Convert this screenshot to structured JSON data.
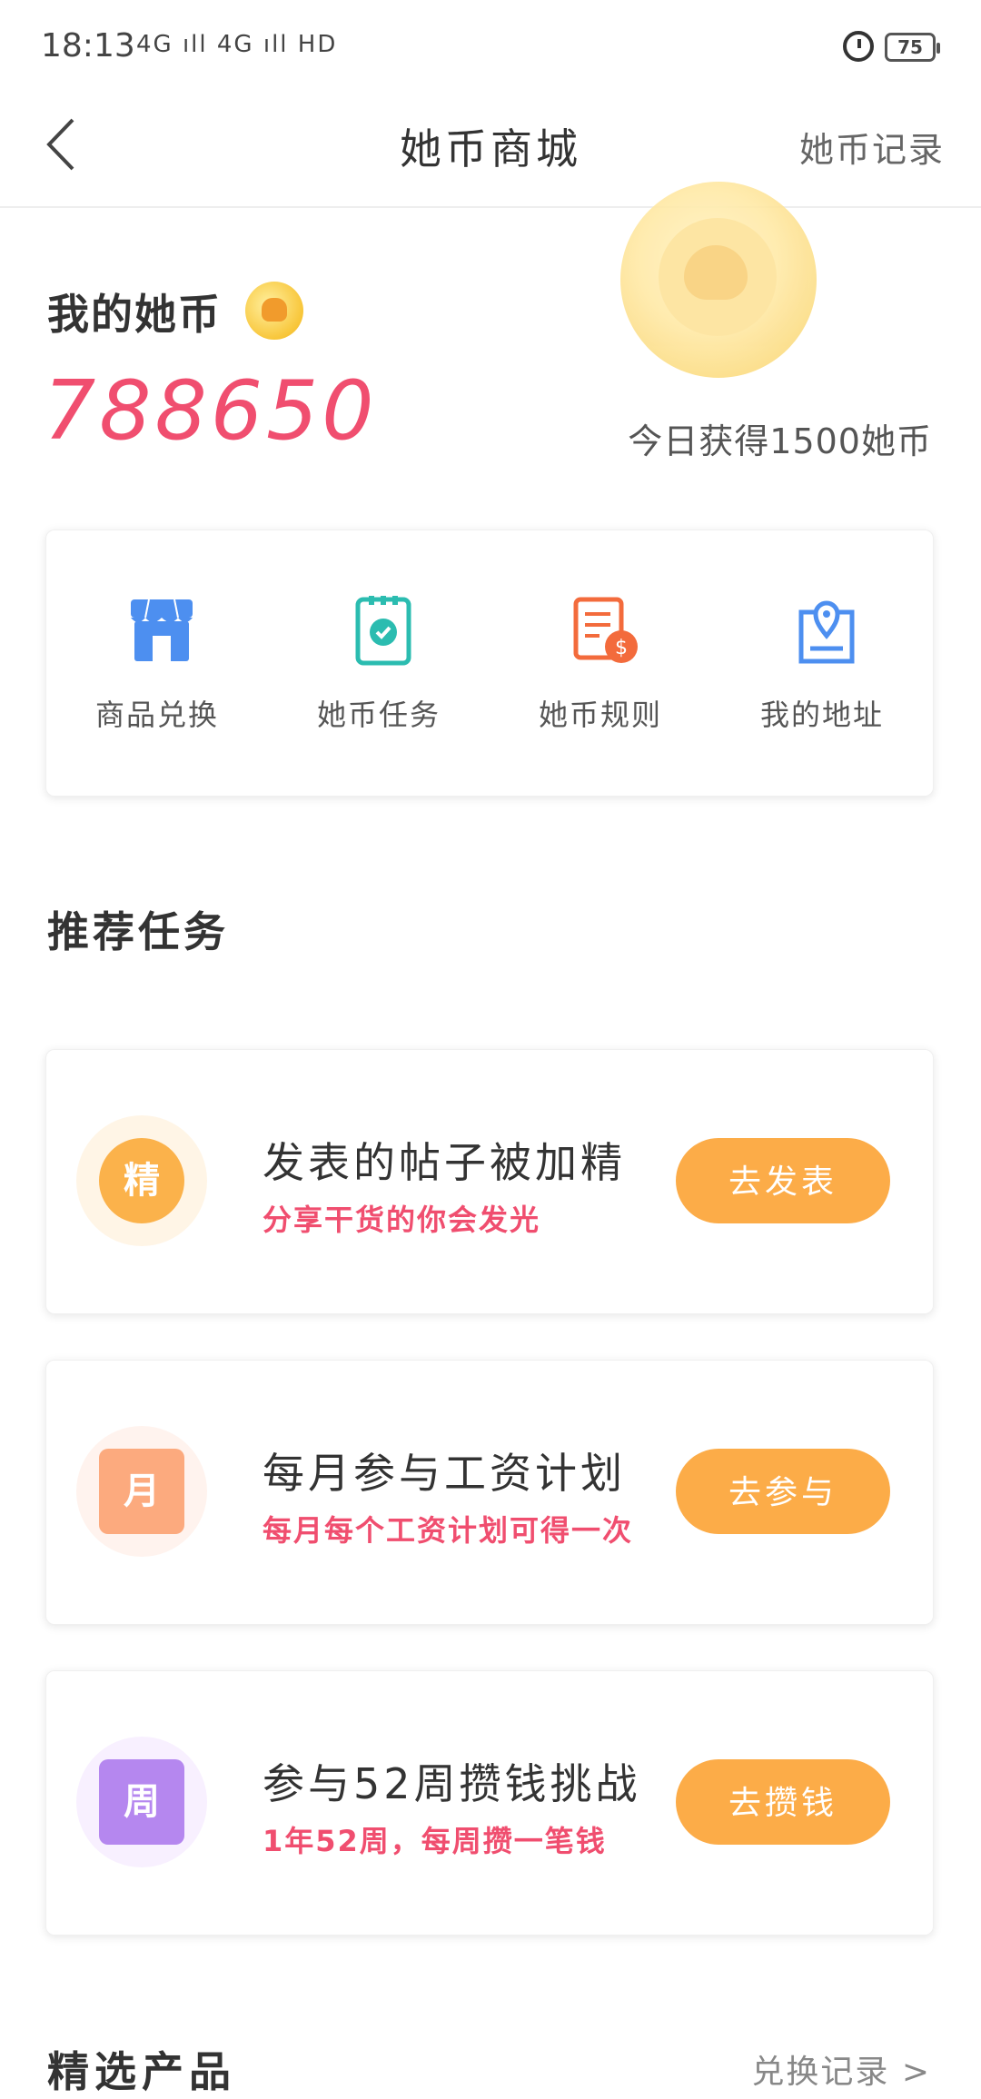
{
  "status_bar": {
    "time": "18:13",
    "signal": "4G ıll  4G ıll HD",
    "battery": "75"
  },
  "nav": {
    "title": "她币商城",
    "right_link": "她币记录"
  },
  "wallet": {
    "label": "我的她币",
    "amount": "788650",
    "today": "今日获得1500她币"
  },
  "functions": [
    {
      "label": "商品兑换",
      "icon": "store-icon",
      "color": "#4d8ff0"
    },
    {
      "label": "她币任务",
      "icon": "task-clipboard-icon",
      "color": "#2bbcb0"
    },
    {
      "label": "她币规则",
      "icon": "rules-document-icon",
      "color": "#f36b3c"
    },
    {
      "label": "我的地址",
      "icon": "location-icon",
      "color": "#4d8ff0"
    }
  ],
  "recommended": {
    "title": "推荐任务",
    "tasks": [
      {
        "badge": "精",
        "title": "发表的帖子被加精",
        "subtitle": "分享干货的你会发光",
        "button": "去发表",
        "badge_color": "#fbb24b",
        "badge_bg": "#fff5e6"
      },
      {
        "badge": "月",
        "title": "每月参与工资计划",
        "subtitle": "每月每个工资计划可得一次",
        "button": "去参与",
        "badge_color": "#fcaa7e",
        "badge_bg": "#fff3ee"
      },
      {
        "badge": "周",
        "title": "参与52周攒钱挑战",
        "subtitle": "1年52周，每周攒一笔钱",
        "button": "去攒钱",
        "badge_color": "#b587ef",
        "badge_bg": "#f8f0ff"
      }
    ]
  },
  "featured": {
    "title": "精选产品",
    "link": "兑换记录 >"
  },
  "colors": {
    "accent_red": "#f04e6f",
    "button_orange": "#fcac48"
  }
}
